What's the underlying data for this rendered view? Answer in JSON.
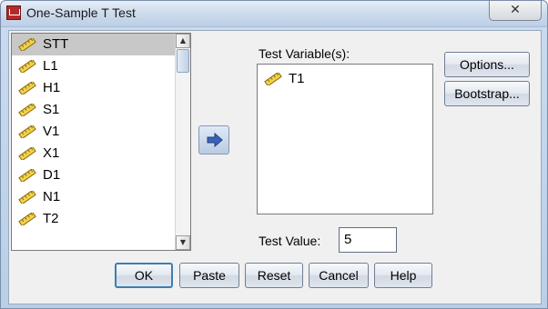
{
  "window": {
    "title": "One-Sample T Test",
    "close_label": "✕"
  },
  "variable_list": {
    "items": [
      {
        "label": "STT",
        "selected": true
      },
      {
        "label": "L1",
        "selected": false
      },
      {
        "label": "H1",
        "selected": false
      },
      {
        "label": "S1",
        "selected": false
      },
      {
        "label": "V1",
        "selected": false
      },
      {
        "label": "X1",
        "selected": false
      },
      {
        "label": "D1",
        "selected": false
      },
      {
        "label": "N1",
        "selected": false
      },
      {
        "label": "T2",
        "selected": false
      }
    ],
    "scroll_up": "▲",
    "scroll_down": "▼"
  },
  "test_variables": {
    "label": "Test Variable(s):",
    "items": [
      {
        "label": "T1"
      }
    ]
  },
  "test_value": {
    "label": "Test Value:",
    "value": "5"
  },
  "side_buttons": {
    "options": "Options...",
    "bootstrap": "Bootstrap..."
  },
  "bottom_buttons": {
    "ok": "OK",
    "paste": "Paste",
    "reset": "Reset",
    "cancel": "Cancel",
    "help": "Help"
  },
  "icons": {
    "variable": "scale-ruler-icon",
    "move": "move-right-arrow-icon",
    "app": "spss-app-icon",
    "close": "close-icon"
  },
  "colors": {
    "ruler_fill": "#f1d24a",
    "ruler_stroke": "#8a6a10",
    "arrow_blue": "#3a63b8",
    "selection": "#c8c8c8"
  }
}
